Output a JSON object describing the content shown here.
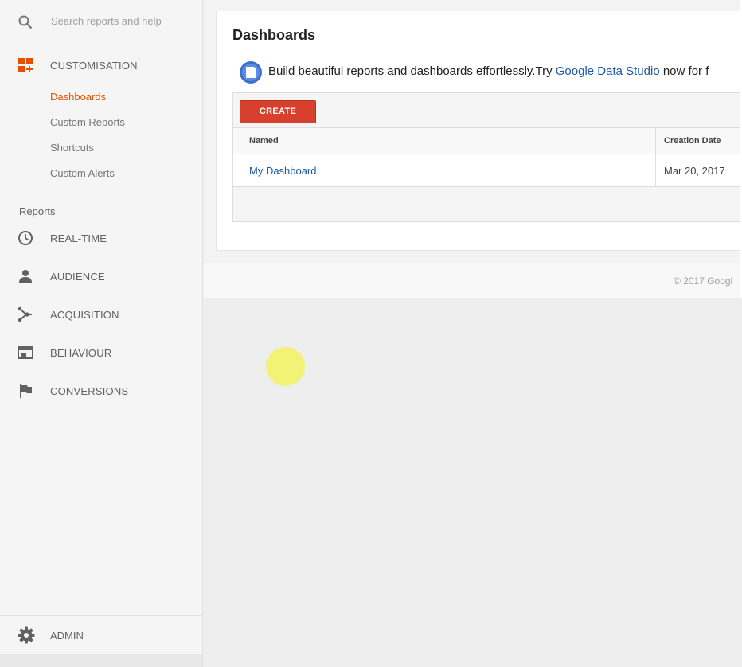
{
  "sidebar": {
    "search_placeholder": "Search reports and help",
    "customisation": {
      "label": "CUSTOMISATION",
      "items": [
        {
          "label": "Dashboards",
          "active": true
        },
        {
          "label": "Custom Reports"
        },
        {
          "label": "Shortcuts"
        },
        {
          "label": "Custom Alerts"
        }
      ]
    },
    "reports_heading": "Reports",
    "nav": [
      {
        "label": "REAL-TIME",
        "icon": "clock-icon"
      },
      {
        "label": "AUDIENCE",
        "icon": "person-icon"
      },
      {
        "label": "ACQUISITION",
        "icon": "acquisition-icon"
      },
      {
        "label": "BEHAVIOUR",
        "icon": "behaviour-icon"
      },
      {
        "label": "CONVERSIONS",
        "icon": "flag-icon"
      }
    ],
    "admin_label": "ADMIN"
  },
  "main": {
    "title": "Dashboards",
    "promo": {
      "text_before": "Build beautiful reports and dashboards effortlessly.Try ",
      "link": "Google Data Studio",
      "text_after": " now for f"
    },
    "create_label": "CREATE",
    "table": {
      "columns": [
        "Named",
        "Creation Date"
      ],
      "rows": [
        {
          "named": "My Dashboard",
          "date": "Mar 20, 2017"
        }
      ]
    },
    "footer_copyright": "© 2017 Googl"
  },
  "colors": {
    "accent": "#e65100",
    "create_button": "#d7402d",
    "link": "#1a58a6"
  }
}
